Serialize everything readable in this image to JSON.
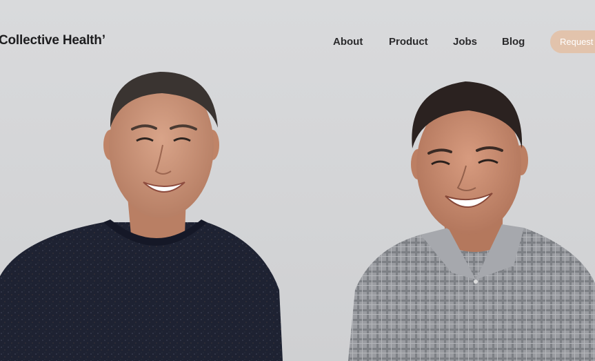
{
  "header": {
    "logo_text": "Collective Health’",
    "nav": {
      "about": "About",
      "product": "Product",
      "jobs": "Jobs",
      "blog": "Blog"
    },
    "cta_label": "Request a"
  },
  "hero": {
    "people": [
      "left-person-dark-sweater",
      "right-person-plaid-shirt"
    ]
  },
  "colors": {
    "background": "#d6d7d9",
    "cta": "#e2c3ac",
    "nav_text": "#2a2a2c",
    "sweater": "#1f2433",
    "shirt": "#8c8f94"
  }
}
